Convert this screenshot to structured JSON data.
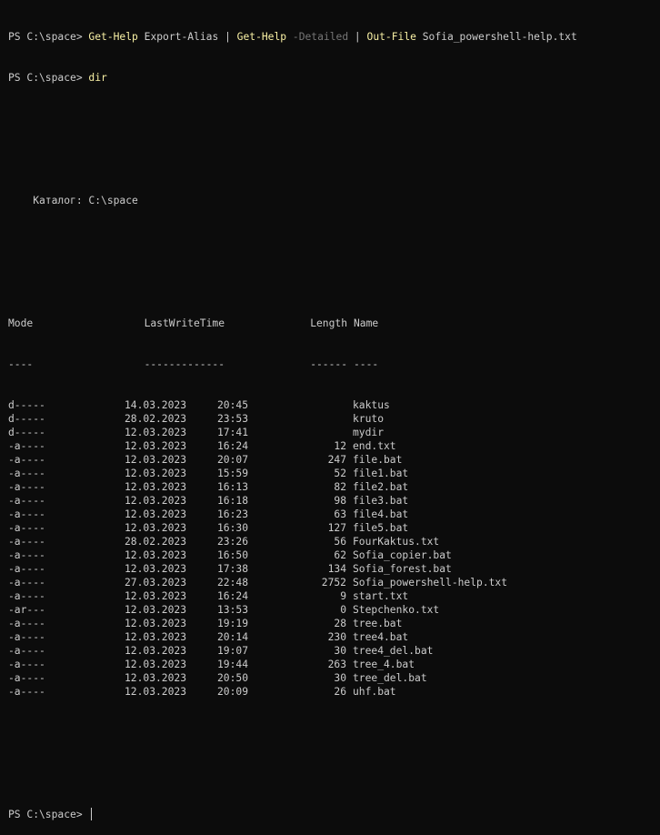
{
  "prompt": "PS C:\\space> ",
  "commands": {
    "first": {
      "cmd1": "Get-Help",
      "arg1": " Export-Alias ",
      "pipe1": "| ",
      "cmd2": "Get-Help",
      "space": " ",
      "flag": "-Detailed",
      "pipe2": " | ",
      "cmd3": "Out-File",
      "arg3": " Sofia_powershell-help.txt"
    },
    "second": "dir"
  },
  "directory_label": "    Каталог: C:\\space",
  "headers": {
    "mode": "Mode",
    "lastwrite": "LastWriteTime",
    "length": "Length",
    "name": "Name"
  },
  "underlines": {
    "mode": "----",
    "lastwrite": "-------------",
    "length": "------",
    "name": "----"
  },
  "entries": [
    {
      "mode": "d-----",
      "date": "14.03.2023",
      "time": "20:45",
      "length": "",
      "name": "kaktus"
    },
    {
      "mode": "d-----",
      "date": "28.02.2023",
      "time": "23:53",
      "length": "",
      "name": "kruto"
    },
    {
      "mode": "d-----",
      "date": "12.03.2023",
      "time": "17:41",
      "length": "",
      "name": "mydir"
    },
    {
      "mode": "-a----",
      "date": "12.03.2023",
      "time": "16:24",
      "length": "12",
      "name": "end.txt"
    },
    {
      "mode": "-a----",
      "date": "12.03.2023",
      "time": "20:07",
      "length": "247",
      "name": "file.bat"
    },
    {
      "mode": "-a----",
      "date": "12.03.2023",
      "time": "15:59",
      "length": "52",
      "name": "file1.bat"
    },
    {
      "mode": "-a----",
      "date": "12.03.2023",
      "time": "16:13",
      "length": "82",
      "name": "file2.bat"
    },
    {
      "mode": "-a----",
      "date": "12.03.2023",
      "time": "16:18",
      "length": "98",
      "name": "file3.bat"
    },
    {
      "mode": "-a----",
      "date": "12.03.2023",
      "time": "16:23",
      "length": "63",
      "name": "file4.bat"
    },
    {
      "mode": "-a----",
      "date": "12.03.2023",
      "time": "16:30",
      "length": "127",
      "name": "file5.bat"
    },
    {
      "mode": "-a----",
      "date": "28.02.2023",
      "time": "23:26",
      "length": "56",
      "name": "FourKaktus.txt"
    },
    {
      "mode": "-a----",
      "date": "12.03.2023",
      "time": "16:50",
      "length": "62",
      "name": "Sofia_copier.bat"
    },
    {
      "mode": "-a----",
      "date": "12.03.2023",
      "time": "17:38",
      "length": "134",
      "name": "Sofia_forest.bat"
    },
    {
      "mode": "-a----",
      "date": "27.03.2023",
      "time": "22:48",
      "length": "2752",
      "name": "Sofia_powershell-help.txt"
    },
    {
      "mode": "-a----",
      "date": "12.03.2023",
      "time": "16:24",
      "length": "9",
      "name": "start.txt"
    },
    {
      "mode": "-ar---",
      "date": "12.03.2023",
      "time": "13:53",
      "length": "0",
      "name": "Stepchenko.txt"
    },
    {
      "mode": "-a----",
      "date": "12.03.2023",
      "time": "19:19",
      "length": "28",
      "name": "tree.bat"
    },
    {
      "mode": "-a----",
      "date": "12.03.2023",
      "time": "20:14",
      "length": "230",
      "name": "tree4.bat"
    },
    {
      "mode": "-a----",
      "date": "12.03.2023",
      "time": "19:07",
      "length": "30",
      "name": "tree4_del.bat"
    },
    {
      "mode": "-a----",
      "date": "12.03.2023",
      "time": "19:44",
      "length": "263",
      "name": "tree_4.bat"
    },
    {
      "mode": "-a----",
      "date": "12.03.2023",
      "time": "20:50",
      "length": "30",
      "name": "tree_del.bat"
    },
    {
      "mode": "-a----",
      "date": "12.03.2023",
      "time": "20:09",
      "length": "26",
      "name": "uhf.bat"
    }
  ],
  "colors": {
    "background": "#0c0c0c",
    "text": "#cccccc",
    "command": "#f9f1a5",
    "parameter": "#767676"
  }
}
